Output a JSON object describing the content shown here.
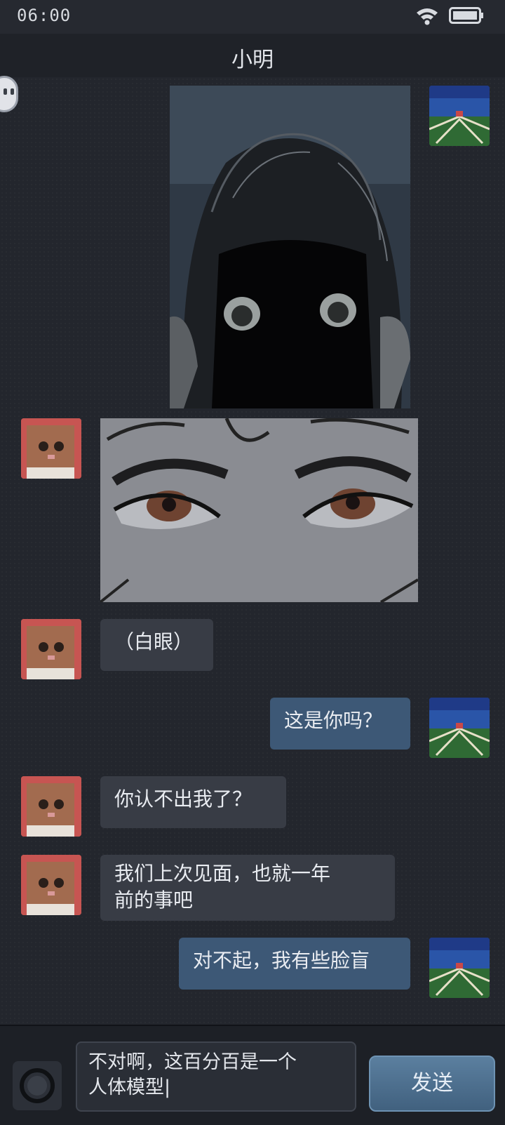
{
  "status_bar": {
    "time": "06:00",
    "wifi_icon": "wifi-icon",
    "battery_icon": "battery-icon"
  },
  "header": {
    "title": "小明"
  },
  "messages": [
    {
      "kind": "image",
      "side": "outgoing",
      "description_icon": "portrait-photo"
    },
    {
      "kind": "image",
      "side": "incoming",
      "description_icon": "eyes-photo"
    },
    {
      "kind": "text",
      "side": "incoming",
      "text": "（白眼）"
    },
    {
      "kind": "text",
      "side": "outgoing",
      "text": "这是你吗？"
    },
    {
      "kind": "text",
      "side": "incoming",
      "text": "你认不出我了？"
    },
    {
      "kind": "text",
      "side": "incoming",
      "text": "我们上次见面，也就一年\n前的事吧"
    },
    {
      "kind": "text",
      "side": "outgoing",
      "text": "对不起，我有些脸盲"
    }
  ],
  "composer": {
    "input_value": "不对啊，这百分百是一个\n人体模型|",
    "send_label": "发送",
    "camera_icon": "camera-icon"
  },
  "colors": {
    "background": "#23262d",
    "incoming_bubble": "#383c45",
    "outgoing_bubble": "#3d5876",
    "accent": "#5b7f9f"
  }
}
